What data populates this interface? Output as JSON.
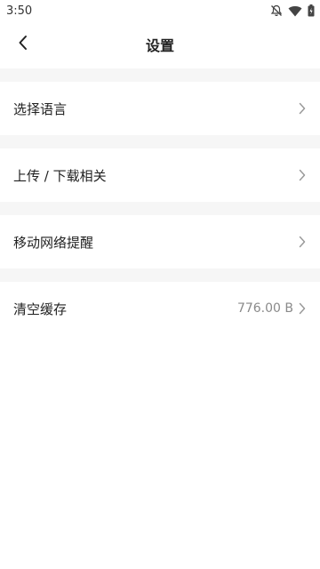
{
  "status_bar": {
    "time": "3:50",
    "icons": [
      "bell-off-icon",
      "wifi-icon",
      "battery-icon"
    ]
  },
  "header": {
    "title": "设置",
    "back_icon": "chevron-left-icon"
  },
  "settings": {
    "items": [
      {
        "label": "选择语言",
        "value": ""
      },
      {
        "label": "上传 / 下载相关",
        "value": ""
      },
      {
        "label": "移动网络提醒",
        "value": ""
      },
      {
        "label": "清空缓存",
        "value": "776.00 B"
      }
    ]
  },
  "colors": {
    "separator": "#f6f6f6",
    "text": "#222222",
    "secondary_text": "#8a8a8a",
    "chevron": "#9a9a9a"
  }
}
